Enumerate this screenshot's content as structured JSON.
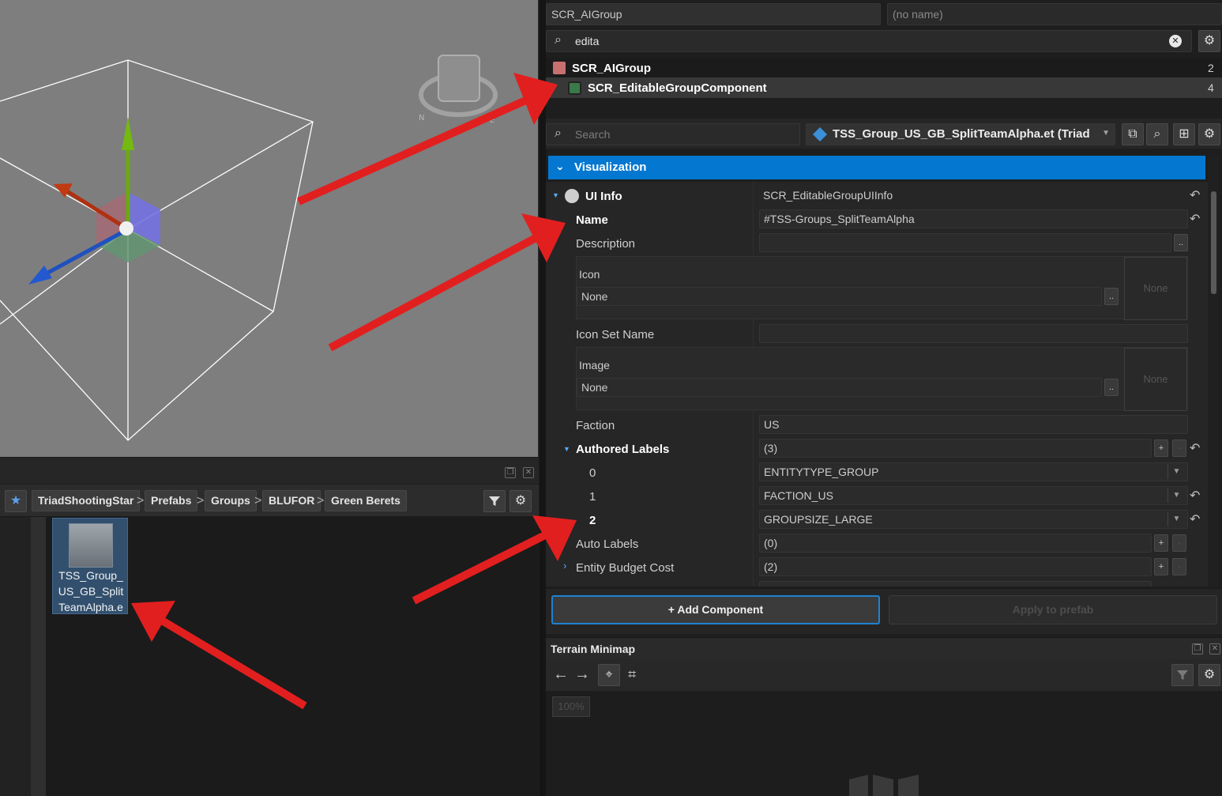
{
  "colors": {
    "accent": "#0478d0",
    "annotation_arrow": "#e02020",
    "viewport_bg": "#7e7e7e"
  },
  "breadcrumb": {
    "favorite_icon": "star-icon",
    "items": [
      "TriadShootingStar",
      "Prefabs",
      "Groups",
      "BLUFOR",
      "Green Berets"
    ],
    "separator": ">"
  },
  "asset": {
    "name": "TSS_Group_US_GB_SplitTeamAlpha.e",
    "name_lines": [
      "TSS_Group_",
      "US_GB_Split",
      "TeamAlpha.e"
    ]
  },
  "entity": {
    "class_name": "SCR_AIGroup",
    "name_placeholder": "(no name)"
  },
  "component_filter": {
    "value": "edita"
  },
  "hierarchy": [
    {
      "label": "SCR_AIGroup",
      "count": "2"
    },
    {
      "label": "SCR_EditableGroupComponent",
      "count": "4"
    }
  ],
  "properties_toolbar": {
    "search_placeholder": "Search",
    "prefab_label": "TSS_Group_US_GB_SplitTeamAlpha.et (Triad"
  },
  "visualization": {
    "section_title": "Visualization",
    "ui_info": {
      "label": "UI Info",
      "value": "SCR_EditableGroupUIInfo"
    },
    "name": {
      "label": "Name",
      "value": "#TSS-Groups_SplitTeamAlpha"
    },
    "description": {
      "label": "Description",
      "value": "",
      "browse": ".."
    },
    "icon": {
      "label": "Icon",
      "value": "None",
      "preview": "None",
      "browse": ".."
    },
    "icon_set_name": {
      "label": "Icon Set Name",
      "value": ""
    },
    "image": {
      "label": "Image",
      "value": "None",
      "preview": "None",
      "browse": ".."
    },
    "faction": {
      "label": "Faction",
      "value": "US"
    },
    "authored_labels": {
      "label": "Authored Labels",
      "count": "(3)",
      "items": [
        {
          "index": "0",
          "value": "ENTITYTYPE_GROUP"
        },
        {
          "index": "1",
          "value": "FACTION_US"
        },
        {
          "index": "2",
          "value": "GROUPSIZE_LARGE"
        }
      ]
    },
    "auto_labels": {
      "label": "Auto Labels",
      "count": "(0)"
    },
    "entity_budget_cost": {
      "label": "Entity Budget Cost",
      "count": "(2)"
    },
    "add_symbol": "+",
    "remove_symbol": "-"
  },
  "footer": {
    "add_component": "+ Add Component",
    "apply_to_prefab": "Apply to prefab"
  },
  "minimap": {
    "title": "Terrain Minimap",
    "zoom": "100%"
  }
}
